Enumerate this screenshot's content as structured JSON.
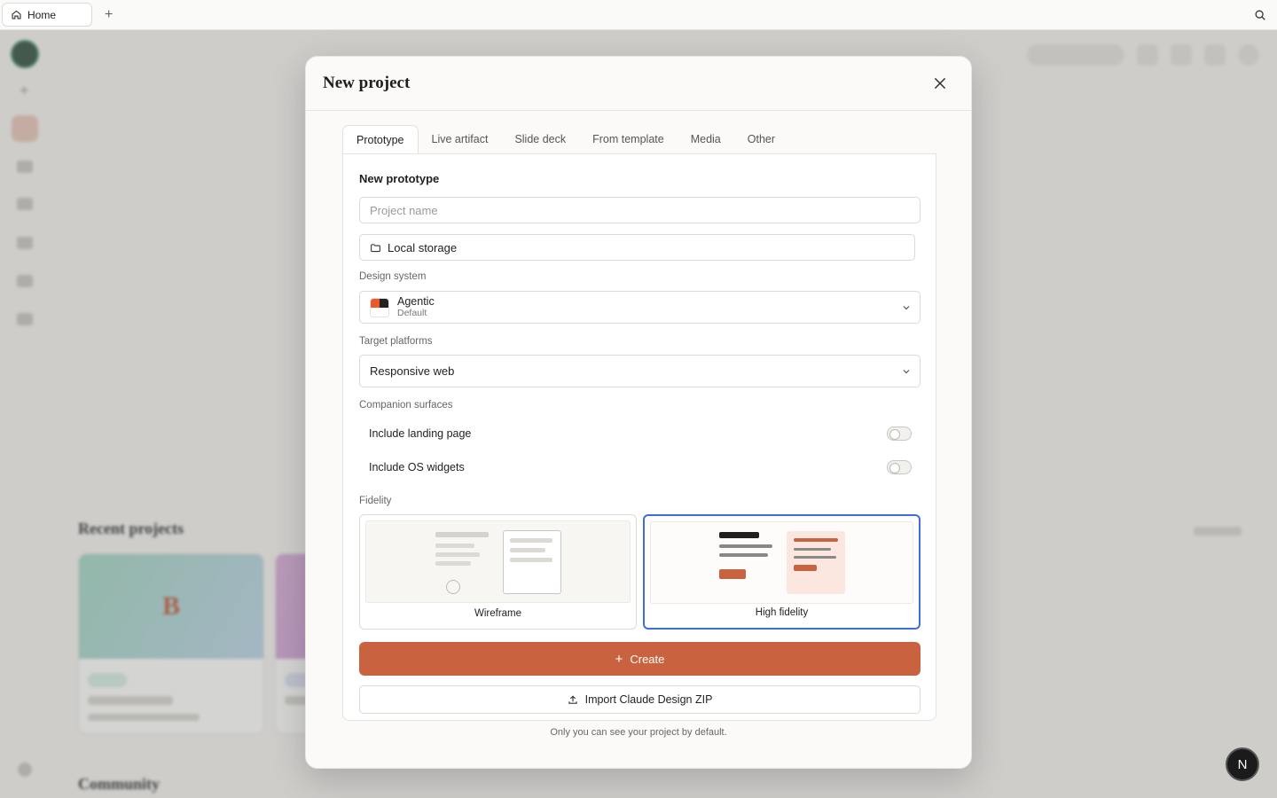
{
  "browser": {
    "tab_label": "Home",
    "new_tab_symbol": "+"
  },
  "background": {
    "recent_title": "Recent projects",
    "community_title": "Community",
    "card_a_letter": "B"
  },
  "modal": {
    "title": "New project",
    "tabs": [
      {
        "label": "Prototype"
      },
      {
        "label": "Live artifact"
      },
      {
        "label": "Slide deck"
      },
      {
        "label": "From template"
      },
      {
        "label": "Media"
      },
      {
        "label": "Other"
      }
    ],
    "section_title": "New prototype",
    "project_name_placeholder": "Project name",
    "storage_label": "Local storage",
    "design_system": {
      "label": "Design system",
      "name": "Agentic",
      "subtitle": "Default"
    },
    "target_platforms": {
      "label": "Target platforms",
      "value": "Responsive web"
    },
    "companion": {
      "label": "Companion surfaces",
      "landing": "Include landing page",
      "widgets": "Include OS widgets"
    },
    "fidelity": {
      "label": "Fidelity",
      "wireframe": "Wireframe",
      "high": "High fidelity"
    },
    "create_label": "Create",
    "import_label": "Import Claude Design ZIP",
    "footnote": "Only you can see your project by default."
  },
  "assistant_badge": "N",
  "colors": {
    "accent": "#c9633f",
    "selected_border": "#3f6fd6"
  }
}
